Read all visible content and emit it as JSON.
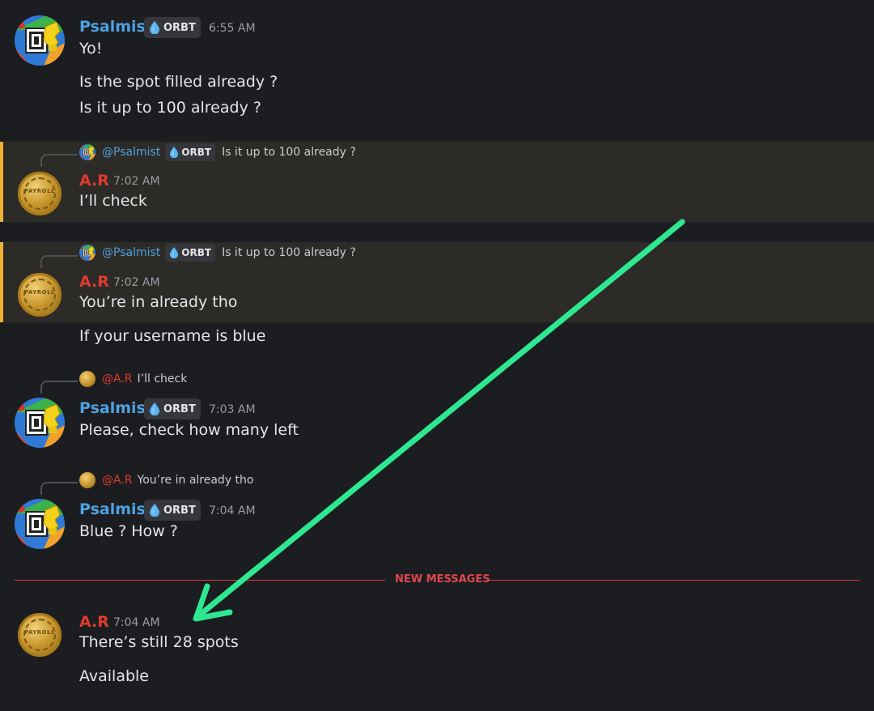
{
  "colors": {
    "background": "#1c1d21",
    "highlight": "#2d2b27",
    "highlight_bar": "#f0b232",
    "username_blue": "#4ea1e0",
    "username_red": "#e03b2e",
    "new_messages": "#e0484b",
    "arrow": "#2ee891"
  },
  "badge_label": "ORBT",
  "messages": {
    "m1": {
      "author": "Psalmist",
      "time": "6:55 AM",
      "lines": [
        "Yo!",
        "Is the spot filled already ?",
        "Is it up to 100 already ?"
      ]
    },
    "m2": {
      "reply_mention": "@Psalmist",
      "reply_text": "Is it up to 100 already ?",
      "author": "A.R",
      "time": "7:02 AM",
      "text": "I’ll check"
    },
    "m3": {
      "reply_mention": "@Psalmist",
      "reply_text": "Is it up to 100 already ?",
      "author": "A.R",
      "time": "7:02 AM",
      "text": "You’re in already tho",
      "followup": "If your username is blue"
    },
    "m4": {
      "reply_mention": "@A.R",
      "reply_text": "I’ll check",
      "author": "Psalmist",
      "time": "7:03 AM",
      "text": "Please, check how many left"
    },
    "m5": {
      "reply_mention": "@A.R",
      "reply_text": "You’re in already tho",
      "author": "Psalmist",
      "time": "7:04 AM",
      "text": "Blue ? How ?"
    },
    "m6": {
      "author": "A.R",
      "time": "7:04 AM",
      "lines": [
        "There’s still 28 spots",
        "Available"
      ]
    }
  },
  "divider": {
    "label": "NEW MESSAGES"
  },
  "coin_text": "PAYROLL",
  "icons": {
    "badge": "water-drop-icon",
    "annotation": "green-arrow"
  }
}
